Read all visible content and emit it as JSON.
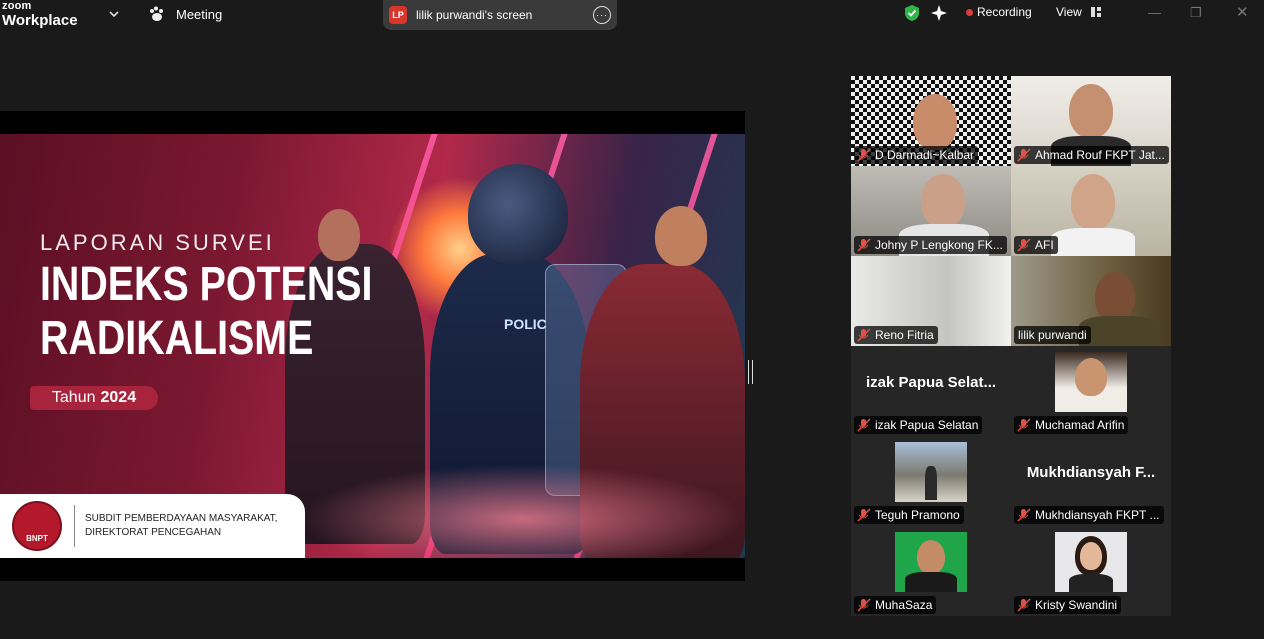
{
  "app": {
    "brand_line1": "zoom",
    "brand_line2": "Workplace"
  },
  "topbar": {
    "meeting_label": "Meeting",
    "share_badge": "LP",
    "share_title": "lilik purwandi's screen",
    "recording_label": "Recording",
    "view_label": "View"
  },
  "slide": {
    "kicker": "LAPORAN SURVEI",
    "title_line1": "INDEKS POTENSI",
    "title_line2": "RADIKALISME",
    "year_label": "Tahun",
    "year": "2024",
    "police_text": "POLIC",
    "logo_text": "BNPT",
    "footer_line1": "SUBDIT PEMBERDAYAAN MASYARAKAT,",
    "footer_line2": "DIREKTORAT PENCEGAHAN"
  },
  "participants": [
    {
      "name": "D Darmadi~Kalbar",
      "muted": true
    },
    {
      "name": "Ahmad Rouf FKPT Jat...",
      "muted": true
    },
    {
      "name": "Johny P Lengkong FK...",
      "muted": true
    },
    {
      "name": "AFI",
      "muted": true
    },
    {
      "name": "Reno Fitria",
      "muted": true
    },
    {
      "name": "lilik purwandi",
      "muted": false,
      "speaking": true
    },
    {
      "name": "izak Papua Selatan",
      "display": "izak Papua Selat...",
      "muted": true
    },
    {
      "name": "Muchamad Arifin",
      "muted": true
    },
    {
      "name": "Teguh Pramono",
      "muted": true
    },
    {
      "name": "Mukhdiansyah FKPT ...",
      "display": "Mukhdiansyah F...",
      "muted": true
    },
    {
      "name": "MuhaSaza",
      "muted": true
    },
    {
      "name": "Kristy Swandini",
      "muted": true
    }
  ],
  "colors": {
    "accent_active": "#2cd07a",
    "muted_mic": "#e0524a",
    "recording": "#e03a3a"
  }
}
